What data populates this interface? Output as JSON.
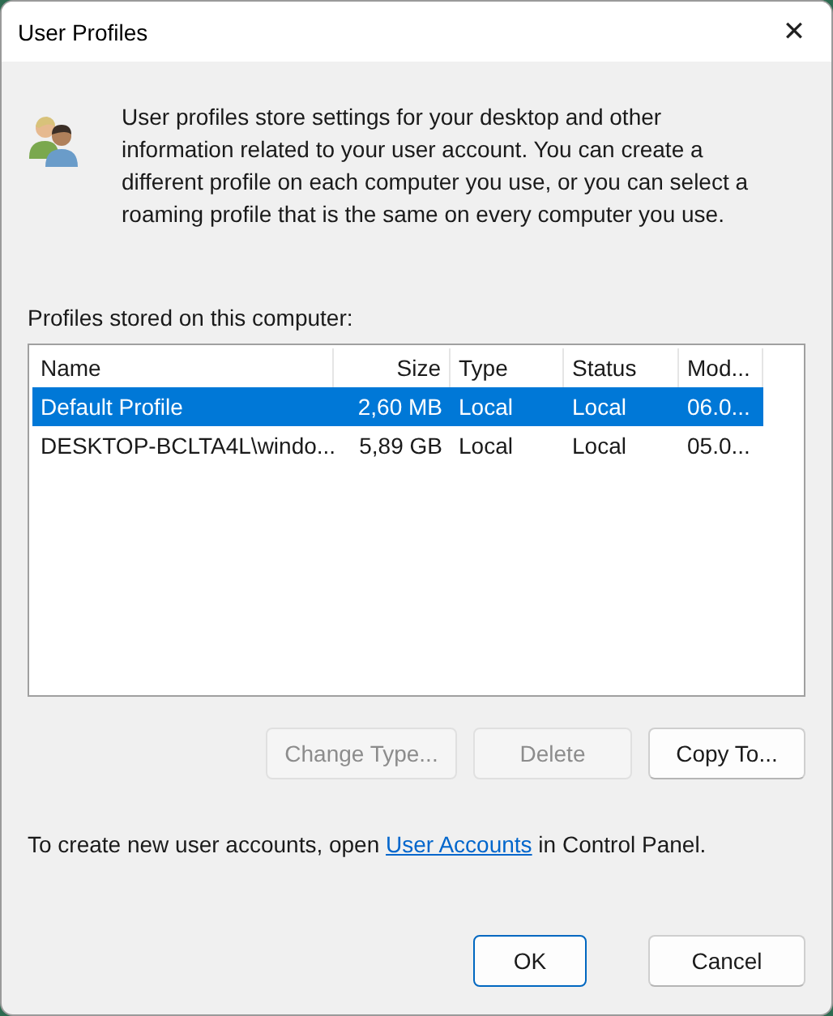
{
  "window": {
    "title": "User Profiles",
    "close": "✕"
  },
  "intro": "User profiles store settings for your desktop and other information related to your user account. You can create a different profile on each computer you use, or you can select a roaming profile that is the same on every computer you use.",
  "list_label": "Profiles stored on this computer:",
  "table": {
    "columns": [
      "Name",
      "Size",
      "Type",
      "Status",
      "Mod..."
    ],
    "rows": [
      {
        "cells": [
          "Default Profile",
          "2,60 MB",
          "Local",
          "Local",
          "06.0..."
        ],
        "selected": true
      },
      {
        "cells": [
          "DESKTOP-BCLTA4L\\windo...",
          "5,89 GB",
          "Local",
          "Local",
          "05.0..."
        ],
        "selected": false
      }
    ]
  },
  "actions": [
    {
      "label": "Change Type...",
      "disabled": true
    },
    {
      "label": "Delete",
      "disabled": true
    },
    {
      "label": "Copy To...",
      "disabled": false
    }
  ],
  "footer": {
    "before": "To create new user accounts, open ",
    "link": "User Accounts",
    "after": " in Control Panel."
  },
  "buttons": [
    {
      "label": "OK",
      "default": true
    },
    {
      "label": "Cancel",
      "default": false
    }
  ]
}
